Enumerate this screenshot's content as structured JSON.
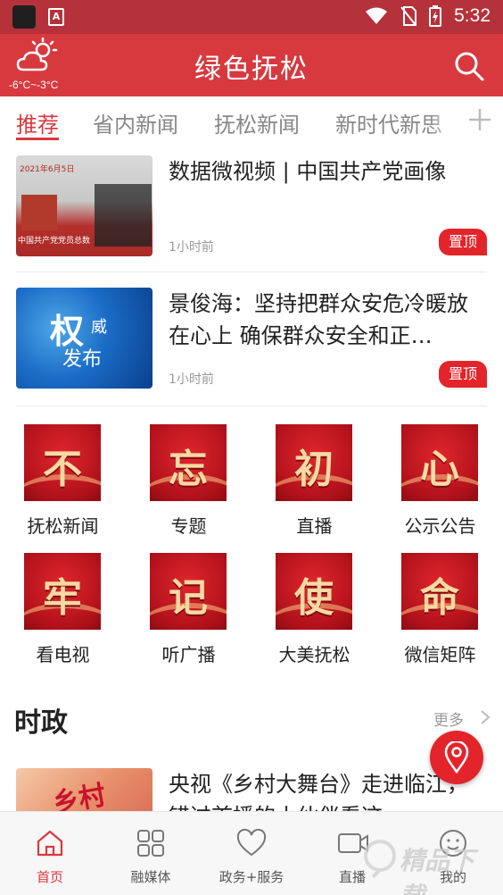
{
  "status_bar": {
    "time": "5:32"
  },
  "header": {
    "title": "绿色抚松",
    "weather": {
      "temperature": "-6°C~-3°C",
      "icon": "partly-cloudy-icon"
    }
  },
  "tabs": [
    {
      "label": "推荐",
      "active": true
    },
    {
      "label": "省内新闻",
      "active": false
    },
    {
      "label": "抚松新闻",
      "active": false
    },
    {
      "label": "新时代新思",
      "active": false
    }
  ],
  "news": [
    {
      "title": "数据微视频 | 中国共产党画像",
      "time": "1小时前",
      "badge": "置顶",
      "thumb_caption_top": "2021年6月5日",
      "thumb_caption_bottom": "中国共产党党员总数"
    },
    {
      "title": "景俊海：坚持把群众安危冷暖放在心上 确保群众安全和正…",
      "time": "1小时前",
      "badge": "置顶",
      "thumb_text_big": "权",
      "thumb_text_1": "威",
      "thumb_text_2": "发布"
    }
  ],
  "grid": [
    {
      "char": "不",
      "label": "抚松新闻"
    },
    {
      "char": "忘",
      "label": "专题"
    },
    {
      "char": "初",
      "label": "直播"
    },
    {
      "char": "心",
      "label": "公示公告"
    },
    {
      "char": "牢",
      "label": "看电视"
    },
    {
      "char": "记",
      "label": "听广播"
    },
    {
      "char": "使",
      "label": "大美抚松"
    },
    {
      "char": "命",
      "label": "微信矩阵"
    }
  ],
  "section": {
    "title": "时政",
    "more": "更多"
  },
  "section_news": [
    {
      "title": "央视《乡村大舞台》走进临江，错过首播的小伙伴看这",
      "thumb_text": "乡村"
    }
  ],
  "bottom_nav": [
    {
      "label": "首页",
      "icon": "home-icon",
      "active": true
    },
    {
      "label": "融媒体",
      "icon": "grid-icon",
      "active": false
    },
    {
      "label": "政务+服务",
      "icon": "heart-icon",
      "active": false
    },
    {
      "label": "直播",
      "icon": "video-camera-icon",
      "active": false
    },
    {
      "label": "我的",
      "icon": "smiley-face-icon",
      "active": false
    }
  ],
  "watermark": {
    "text": "精品下载"
  },
  "colors": {
    "brand_red": "#d7393f",
    "status_bar": "#b5323a",
    "badge_red": "#e3242b"
  }
}
